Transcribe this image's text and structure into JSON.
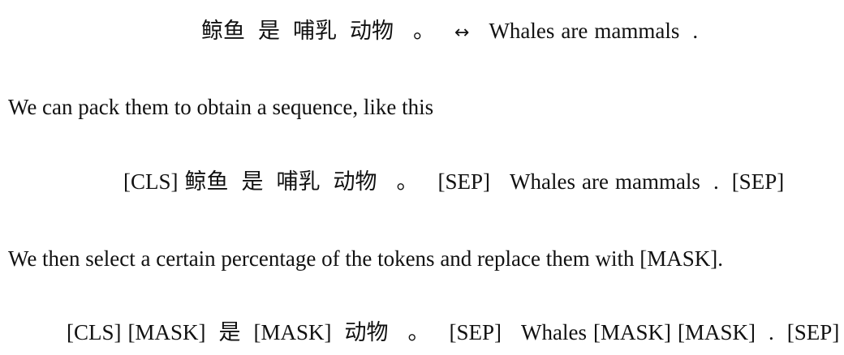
{
  "pair": {
    "zh": [
      "鲸鱼",
      "是",
      "哺乳",
      "动物",
      "。"
    ],
    "arrow": "↔",
    "en": [
      "Whales",
      "are",
      "mammals",
      "."
    ]
  },
  "para1": "We can pack them to obtain a sequence, like this",
  "packed": {
    "cls": "[CLS]",
    "zh": [
      "鲸鱼",
      "是",
      "哺乳",
      "动物",
      "。"
    ],
    "sep1": "[SEP]",
    "en": [
      "Whales",
      "are",
      "mammals",
      "."
    ],
    "sep2": "[SEP]"
  },
  "para2": "We then select a certain percentage of the tokens and replace them with [MASK].",
  "masked": {
    "cls": "[CLS]",
    "zh": [
      "[MASK]",
      "是",
      "[MASK]",
      "动物",
      "。"
    ],
    "sep1": "[SEP]",
    "en": [
      "Whales",
      "[MASK]",
      "[MASK]",
      "."
    ],
    "sep2": "[SEP]"
  }
}
